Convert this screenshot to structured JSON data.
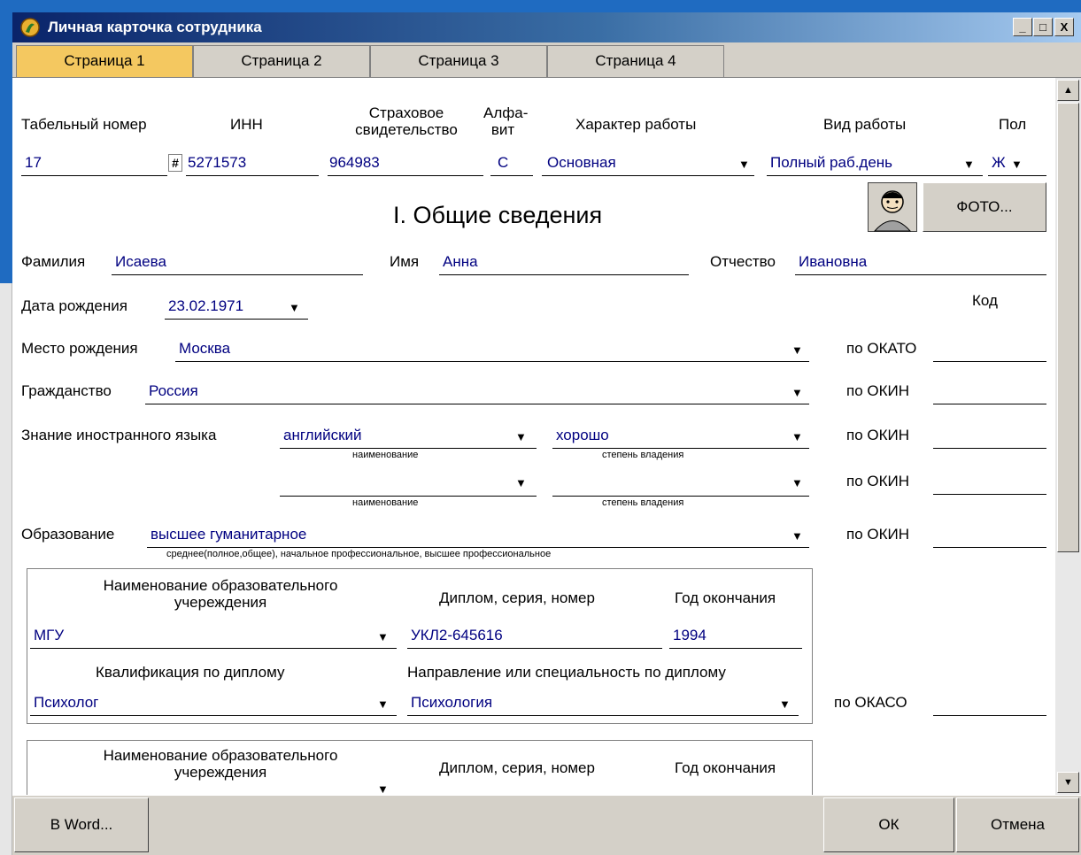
{
  "window": {
    "title": "Личная карточка сотрудника"
  },
  "titlebar_buttons": [
    "_",
    "□",
    "X"
  ],
  "tabs": [
    "Страница 1",
    "Страница 2",
    "Страница 3",
    "Страница 4"
  ],
  "top": {
    "tab_num_label": "Табельный номер",
    "tab_num": "17",
    "hash": "#",
    "inn_label": "ИНН",
    "inn": "5271573",
    "insurance_label": "Страховое свидетельство",
    "insurance": "964983",
    "alpha_label": "Алфа-вит",
    "alpha": "С",
    "work_nature_label": "Характер работы",
    "work_nature": "Основная",
    "work_type_label": "Вид работы",
    "work_type": "Полный раб.день",
    "sex_label": "Пол",
    "sex": "Ж"
  },
  "photo_button": "ФОТО...",
  "section_heading": "I. Общие сведения",
  "person": {
    "surname_label": "Фамилия",
    "surname": "Исаева",
    "name_label": "Имя",
    "name": "Анна",
    "patronymic_label": "Отчество",
    "patronymic": "Ивановна",
    "birth_date_label": "Дата рождения",
    "birth_date": "23.02.1971",
    "code_label": "Код",
    "birthplace_label": "Место рождения",
    "birthplace": "Москва",
    "okato_label": "по ОКАТО",
    "citizenship_label": "Гражданство",
    "citizenship": "Россия",
    "okin_label": "по ОКИН",
    "lang_label": "Знание иностранного языка",
    "lang1": "английский",
    "lang1_level": "хорошо",
    "lang_name_caption": "наименование",
    "lang_level_caption": "степень владения",
    "education_label": "Образование",
    "education": "высшее гуманитарное",
    "education_caption": "среднее(полное,общее), начальное профессиональное, высшее профессиональное",
    "okaso_label": "по ОКАСО"
  },
  "edu1": {
    "institution_label": "Наименование образовательного учереждения",
    "institution": "МГУ",
    "diploma_label": "Диплом, серия, номер",
    "diploma": "УКЛ2-645616",
    "year_label": "Год окончания",
    "year": "1994",
    "qualification_label": "Квалификация по диплому",
    "qualification": "Психолог",
    "specialty_label": "Направление или специальность по диплому",
    "specialty": "Психология"
  },
  "edu2": {
    "institution_label": "Наименование образовательного учереждения",
    "diploma_label": "Диплом, серия, номер",
    "year_label": "Год окончания"
  },
  "buttons": {
    "word": "В Word...",
    "ok": "ОК",
    "cancel": "Отмена"
  }
}
